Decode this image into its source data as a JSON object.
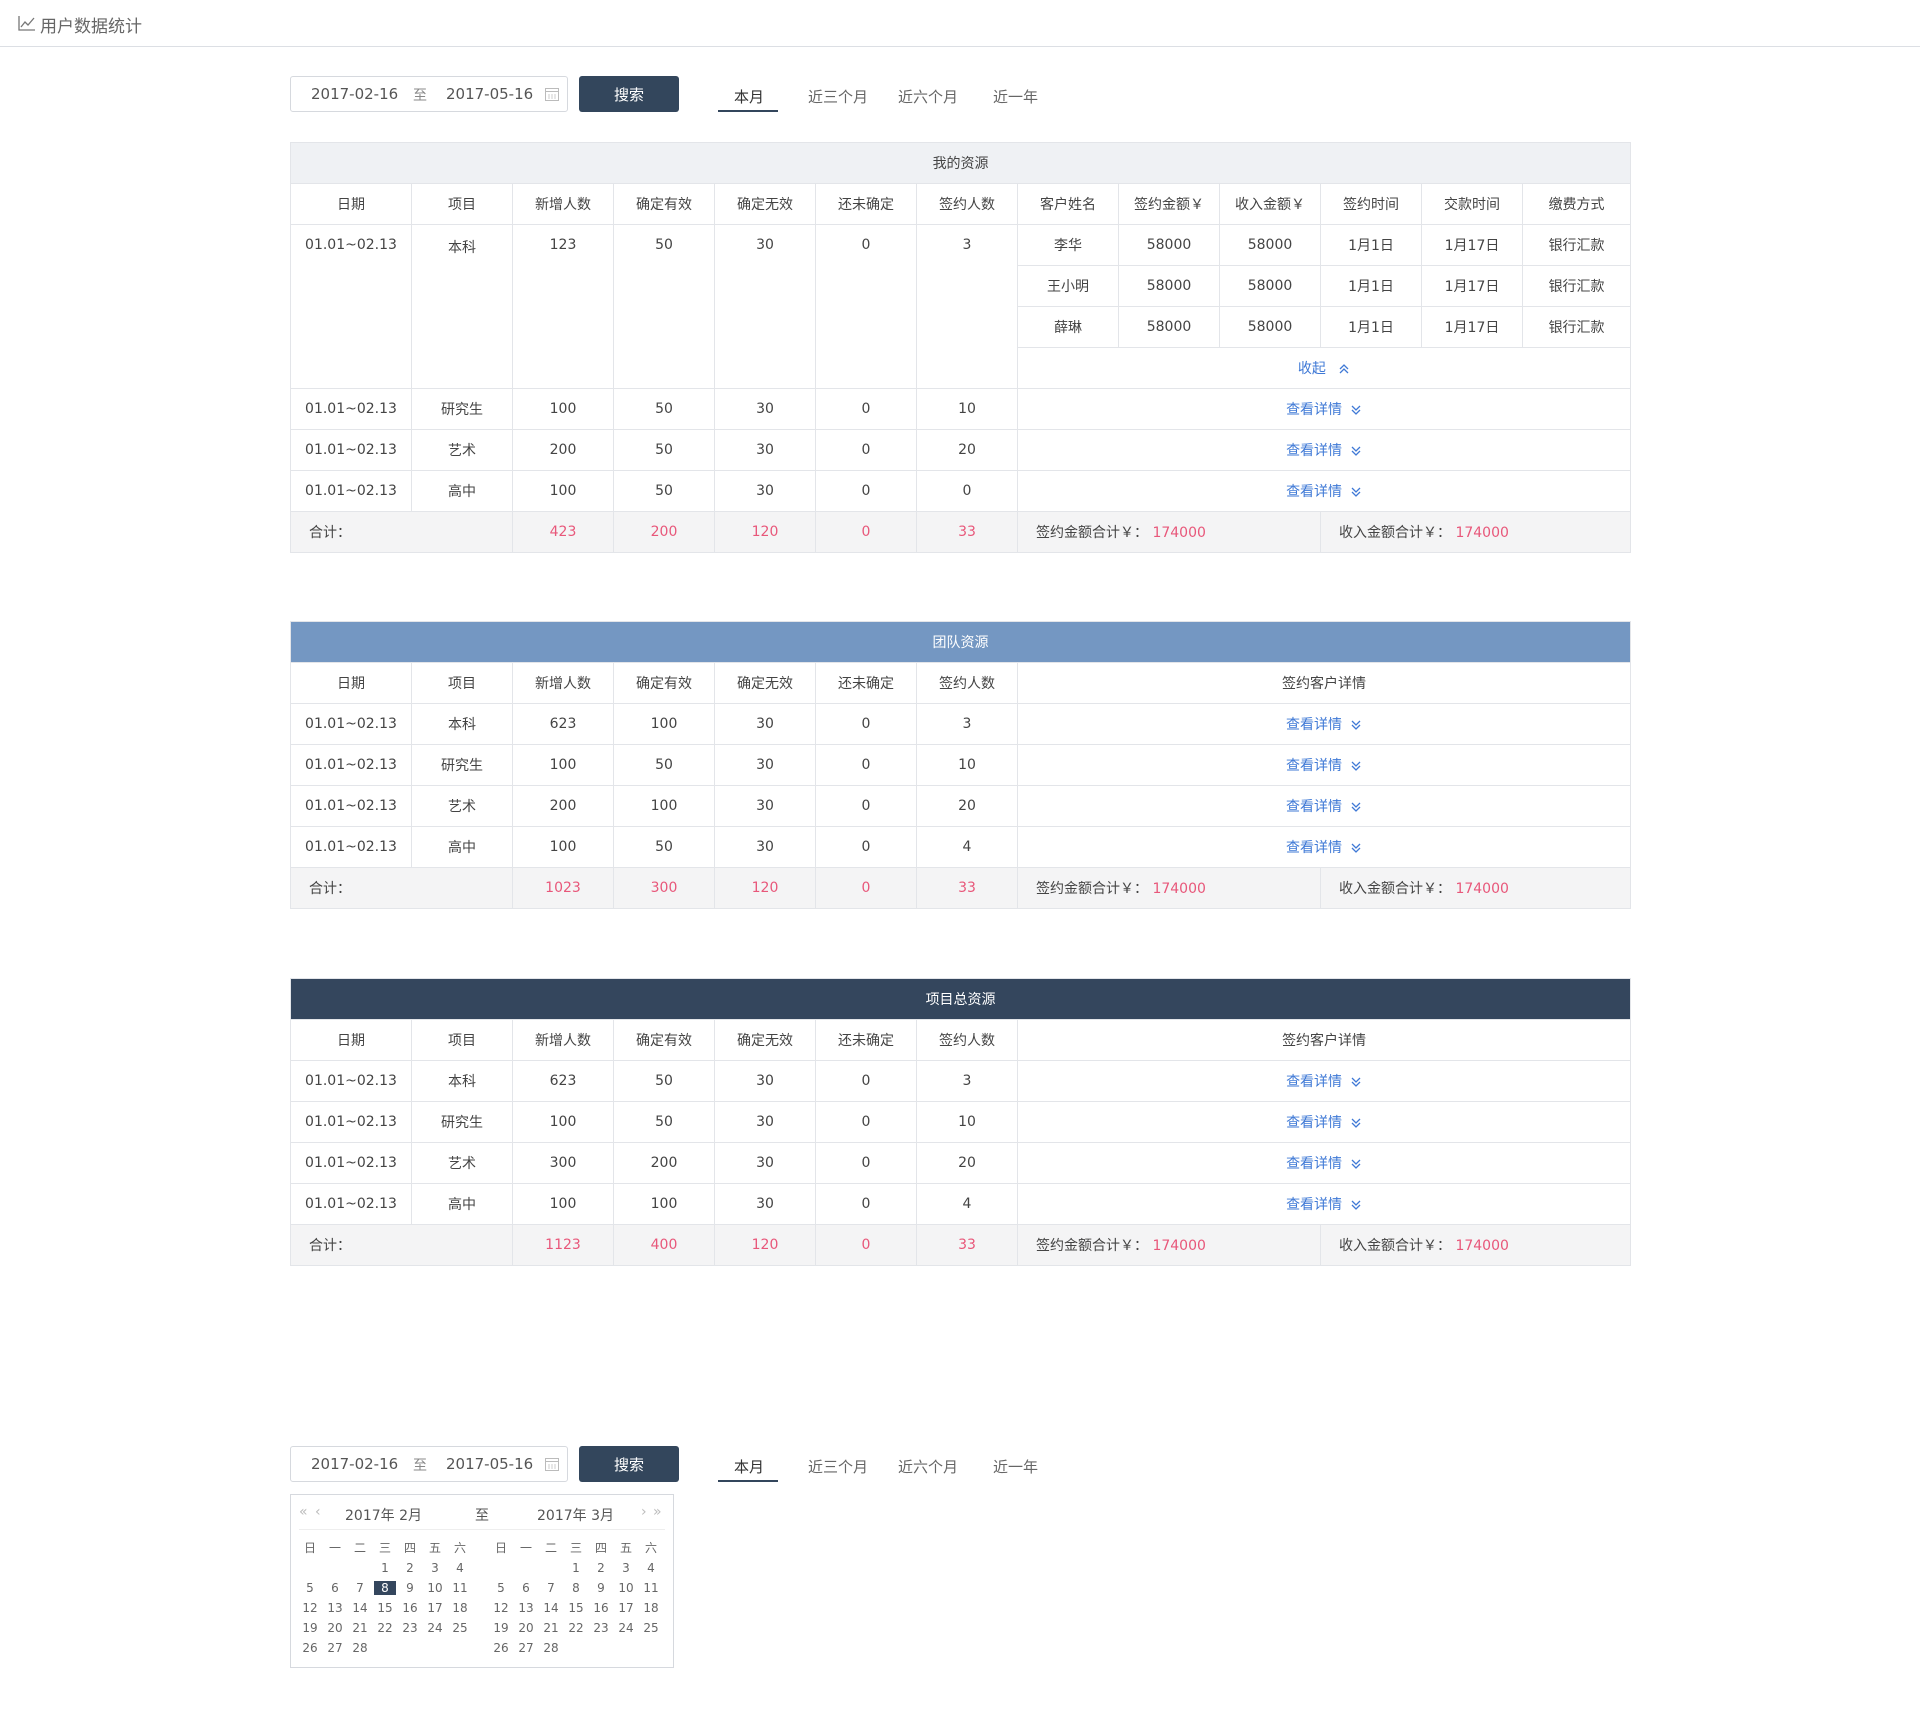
{
  "page": {
    "title": "用户数据统计"
  },
  "toolbar": {
    "start_date": "2017-02-16",
    "to": "至",
    "end_date": "2017-05-16",
    "search_label": "搜索",
    "tabs": [
      "本月",
      "近三个月",
      "近六个月",
      "近一年"
    ]
  },
  "colors": {
    "accent_dark": "#34465d",
    "team_header": "#7497c2",
    "highlight": "#e8577a",
    "link": "#3f79d6"
  },
  "my_resources": {
    "title": "我的资源",
    "headers": [
      "日期",
      "项目",
      "新增人数",
      "确定有效",
      "确定无效",
      "还未确定",
      "签约人数",
      "客户姓名",
      "签约金额￥",
      "收入金额￥",
      "签约时间",
      "交款时间",
      "缴费方式"
    ],
    "first_row": {
      "date": "01.01~02.13",
      "project": "本科",
      "new": "123",
      "valid": "50",
      "invalid": "30",
      "pending": "0",
      "signed": "3"
    },
    "customers": [
      {
        "name": "李华",
        "sign_amount": "58000",
        "income": "58000",
        "sign_time": "1月1日",
        "pay_time": "1月17日",
        "method": "银行汇款"
      },
      {
        "name": "王小明",
        "sign_amount": "58000",
        "income": "58000",
        "sign_time": "1月1日",
        "pay_time": "1月17日",
        "method": "银行汇款"
      },
      {
        "name": "薛琳",
        "sign_amount": "58000",
        "income": "58000",
        "sign_time": "1月1日",
        "pay_time": "1月17日",
        "method": "银行汇款"
      }
    ],
    "collapse_label": "收起",
    "rows": [
      {
        "date": "01.01~02.13",
        "project": "研究生",
        "new": "100",
        "valid": "50",
        "invalid": "30",
        "pending": "0",
        "signed": "10",
        "detail": "查看详情"
      },
      {
        "date": "01.01~02.13",
        "project": "艺术",
        "new": "200",
        "valid": "50",
        "invalid": "30",
        "pending": "0",
        "signed": "20",
        "detail": "查看详情"
      },
      {
        "date": "01.01~02.13",
        "project": "高中",
        "new": "100",
        "valid": "50",
        "invalid": "30",
        "pending": "0",
        "signed": "0",
        "detail": "查看详情"
      }
    ],
    "total": {
      "label": "合计：",
      "new": "423",
      "valid": "200",
      "invalid": "120",
      "pending": "0",
      "signed": "33",
      "sign_sum_label": "签约金额合计￥：",
      "sign_sum": "174000",
      "income_sum_label": "收入金额合计￥：",
      "income_sum": "174000"
    }
  },
  "team_resources": {
    "title": "团队资源",
    "headers": [
      "日期",
      "项目",
      "新增人数",
      "确定有效",
      "确定无效",
      "还未确定",
      "签约人数",
      "签约客户详情"
    ],
    "rows": [
      {
        "date": "01.01~02.13",
        "project": "本科",
        "new": "623",
        "valid": "100",
        "invalid": "30",
        "pending": "0",
        "signed": "3",
        "detail": "查看详情"
      },
      {
        "date": "01.01~02.13",
        "project": "研究生",
        "new": "100",
        "valid": "50",
        "invalid": "30",
        "pending": "0",
        "signed": "10",
        "detail": "查看详情"
      },
      {
        "date": "01.01~02.13",
        "project": "艺术",
        "new": "200",
        "valid": "100",
        "invalid": "30",
        "pending": "0",
        "signed": "20",
        "detail": "查看详情"
      },
      {
        "date": "01.01~02.13",
        "project": "高中",
        "new": "100",
        "valid": "50",
        "invalid": "30",
        "pending": "0",
        "signed": "4",
        "detail": "查看详情"
      }
    ],
    "total": {
      "label": "合计：",
      "new": "1023",
      "valid": "300",
      "invalid": "120",
      "pending": "0",
      "signed": "33",
      "sign_sum_label": "签约金额合计￥：",
      "sign_sum": "174000",
      "income_sum_label": "收入金额合计￥：",
      "income_sum": "174000"
    }
  },
  "project_resources": {
    "title": "项目总资源",
    "headers": [
      "日期",
      "项目",
      "新增人数",
      "确定有效",
      "确定无效",
      "还未确定",
      "签约人数",
      "签约客户详情"
    ],
    "rows": [
      {
        "date": "01.01~02.13",
        "project": "本科",
        "new": "623",
        "valid": "50",
        "invalid": "30",
        "pending": "0",
        "signed": "3",
        "detail": "查看详情"
      },
      {
        "date": "01.01~02.13",
        "project": "研究生",
        "new": "100",
        "valid": "50",
        "invalid": "30",
        "pending": "0",
        "signed": "10",
        "detail": "查看详情"
      },
      {
        "date": "01.01~02.13",
        "project": "艺术",
        "new": "300",
        "valid": "200",
        "invalid": "30",
        "pending": "0",
        "signed": "20",
        "detail": "查看详情"
      },
      {
        "date": "01.01~02.13",
        "project": "高中",
        "new": "100",
        "valid": "100",
        "invalid": "30",
        "pending": "0",
        "signed": "4",
        "detail": "查看详情"
      }
    ],
    "total": {
      "label": "合计：",
      "new": "1123",
      "valid": "400",
      "invalid": "120",
      "pending": "0",
      "signed": "33",
      "sign_sum_label": "签约金额合计￥：",
      "sign_sum": "174000",
      "income_sum_label": "收入金额合计￥：",
      "income_sum": "174000"
    }
  },
  "picker": {
    "left_month": "2017年 2月",
    "to": "至",
    "right_month": "2017年 3月",
    "weekdays": [
      "日",
      "一",
      "二",
      "三",
      "四",
      "五",
      "六"
    ],
    "left_days": [
      [
        "",
        "",
        "",
        "1",
        "2",
        "3",
        "4"
      ],
      [
        "5",
        "6",
        "7",
        "8",
        "9",
        "10",
        "11"
      ],
      [
        "12",
        "13",
        "14",
        "15",
        "16",
        "17",
        "18"
      ],
      [
        "19",
        "20",
        "21",
        "22",
        "23",
        "24",
        "25"
      ],
      [
        "26",
        "27",
        "28",
        "",
        "",
        "",
        ""
      ]
    ],
    "right_days": [
      [
        "",
        "",
        "",
        "1",
        "2",
        "3",
        "4"
      ],
      [
        "5",
        "6",
        "7",
        "8",
        "9",
        "10",
        "11"
      ],
      [
        "12",
        "13",
        "14",
        "15",
        "16",
        "17",
        "18"
      ],
      [
        "19",
        "20",
        "21",
        "22",
        "23",
        "24",
        "25"
      ],
      [
        "26",
        "27",
        "28",
        "",
        "",
        "",
        ""
      ]
    ],
    "selected_day": "8"
  }
}
